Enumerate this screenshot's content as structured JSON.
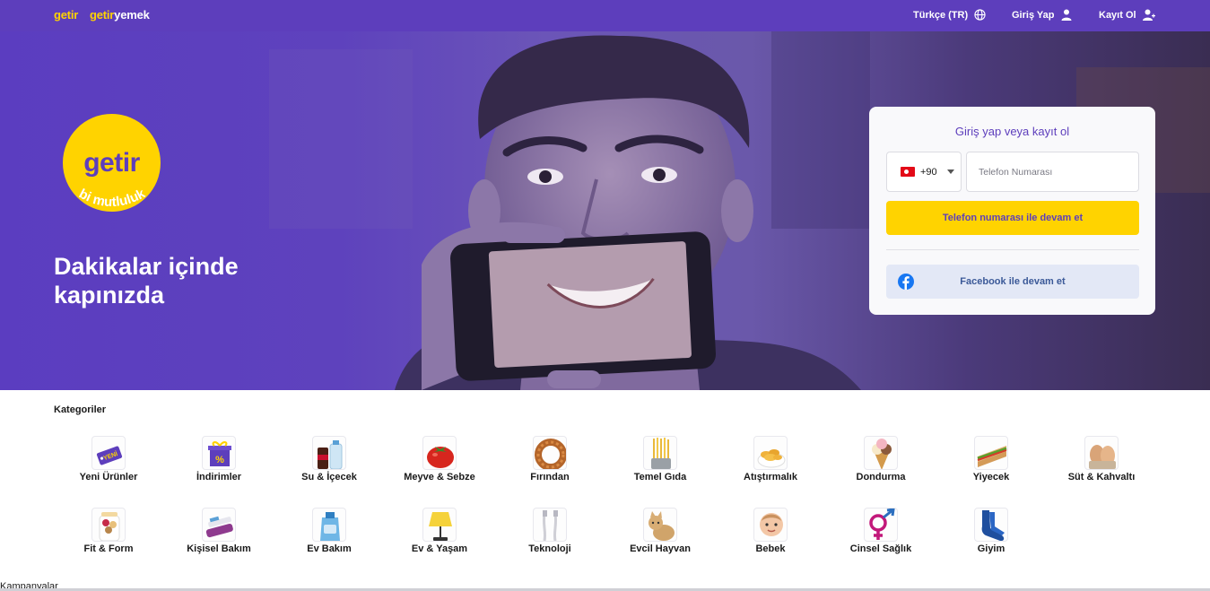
{
  "topbar": {
    "brand_getir": "getir",
    "brand_getiryemek_a": "getir",
    "brand_getiryemek_b": "yemek",
    "language": "Türkçe (TR)",
    "login": "Giriş Yap",
    "register": "Kayıt Ol"
  },
  "hero": {
    "logo_text": "getir",
    "logo_tagline": "bi mutluluk",
    "headline": "Dakikalar içinde kapınızda"
  },
  "login_card": {
    "title": "Giriş yap veya kayıt ol",
    "country_code": "+90",
    "phone_placeholder": "Telefon Numarası",
    "continue_button": "Telefon numarası ile devam et",
    "facebook_button": "Facebook ile devam et"
  },
  "categories": {
    "title": "Kategoriler",
    "items": [
      {
        "label": "Yeni Ürünler",
        "icon": "new-tag-icon"
      },
      {
        "label": "İndirimler",
        "icon": "discount-gift-icon"
      },
      {
        "label": "Su & İçecek",
        "icon": "drinks-icon"
      },
      {
        "label": "Meyve & Sebze",
        "icon": "tomato-icon"
      },
      {
        "label": "Fırından",
        "icon": "simit-icon"
      },
      {
        "label": "Temel Gıda",
        "icon": "pasta-icon"
      },
      {
        "label": "Atıştırmalık",
        "icon": "chips-icon"
      },
      {
        "label": "Dondurma",
        "icon": "ice-cream-icon"
      },
      {
        "label": "Yiyecek",
        "icon": "sandwich-icon"
      },
      {
        "label": "Süt & Kahvaltı",
        "icon": "eggs-icon"
      },
      {
        "label": "Fit & Form",
        "icon": "granola-icon"
      },
      {
        "label": "Kişisel Bakım",
        "icon": "toothbrush-icon"
      },
      {
        "label": "Ev Bakım",
        "icon": "detergent-icon"
      },
      {
        "label": "Ev & Yaşam",
        "icon": "lamp-icon"
      },
      {
        "label": "Teknoloji",
        "icon": "cable-icon"
      },
      {
        "label": "Evcil Hayvan",
        "icon": "cat-icon"
      },
      {
        "label": "Bebek",
        "icon": "baby-icon"
      },
      {
        "label": "Cinsel Sağlık",
        "icon": "gender-icon"
      },
      {
        "label": "Giyim",
        "icon": "socks-icon"
      }
    ]
  },
  "campaigns": {
    "title": "Kampanyalar"
  },
  "colors": {
    "brand_purple": "#5d3ebc",
    "brand_yellow": "#ffd300",
    "facebook_blue": "#1877f2"
  }
}
